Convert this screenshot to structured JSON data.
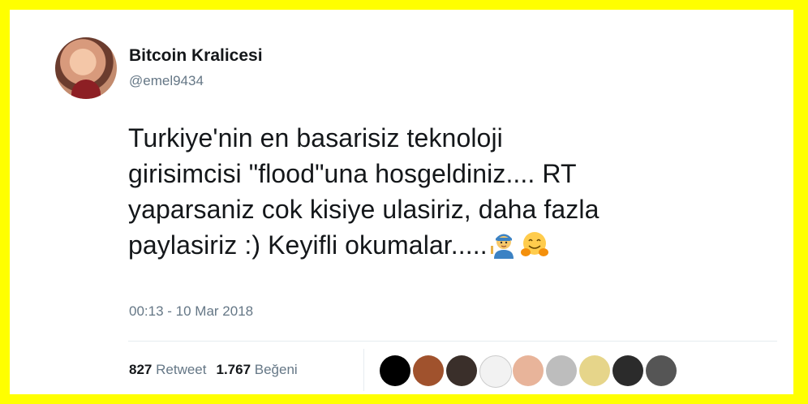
{
  "author": {
    "display_name": "Bitcoin Kralicesi",
    "handle": "@emel9434"
  },
  "tweet": {
    "lines": [
      "Turkiye'nin en basarisiz teknoloji",
      "girisimcisi \"flood\"una hosgeldiniz.... RT",
      "yaparsaniz cok kisiye ulasiriz, daha fazla",
      "paylasiriz :) Keyifli okumalar....."
    ],
    "emojis": [
      "woman-technologist-emoji",
      "hugging-face-emoji"
    ],
    "timestamp": "00:13 - 10 Mar 2018"
  },
  "stats": {
    "retweet_count": "827",
    "retweet_label": "Retweet",
    "like_count": "1.767",
    "like_label": "Beğeni"
  },
  "likers": [
    {
      "name": "liker-avatar-1",
      "color": "#000000"
    },
    {
      "name": "liker-avatar-2",
      "color": "#a0522d"
    },
    {
      "name": "liker-avatar-3",
      "color": "#3a2f2a"
    },
    {
      "name": "liker-avatar-4",
      "color": "#f2f2f2"
    },
    {
      "name": "liker-avatar-5",
      "color": "#e8b49a"
    },
    {
      "name": "liker-avatar-6",
      "color": "#bdbdbd"
    },
    {
      "name": "liker-avatar-7",
      "color": "#e6d58a"
    },
    {
      "name": "liker-avatar-8",
      "color": "#2b2b2b"
    },
    {
      "name": "liker-avatar-9",
      "color": "#555555"
    }
  ],
  "colors": {
    "frame": "#ffff00",
    "text": "#14171a",
    "muted": "#657786"
  }
}
